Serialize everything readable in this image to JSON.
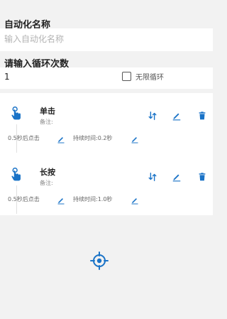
{
  "header": {
    "name_label": "自动化名称",
    "name_placeholder": "输入自动化名称",
    "loop_label": "请输入循环次数",
    "loop_value": "1",
    "infinite_label": "无限循环"
  },
  "actions": [
    {
      "title": "单击",
      "note_label": "备注:",
      "delay": "0.5秒后点击",
      "duration": "持续时间:0.2秒",
      "icon": "tap-hand-icon"
    },
    {
      "title": "长按",
      "note_label": "备注:",
      "delay": "0.5秒后点击",
      "duration": "持续时间:1.0秒",
      "icon": "long-press-hand-icon"
    }
  ],
  "colors": {
    "accent": "#1a73c7",
    "background": "#f2f2f2"
  }
}
